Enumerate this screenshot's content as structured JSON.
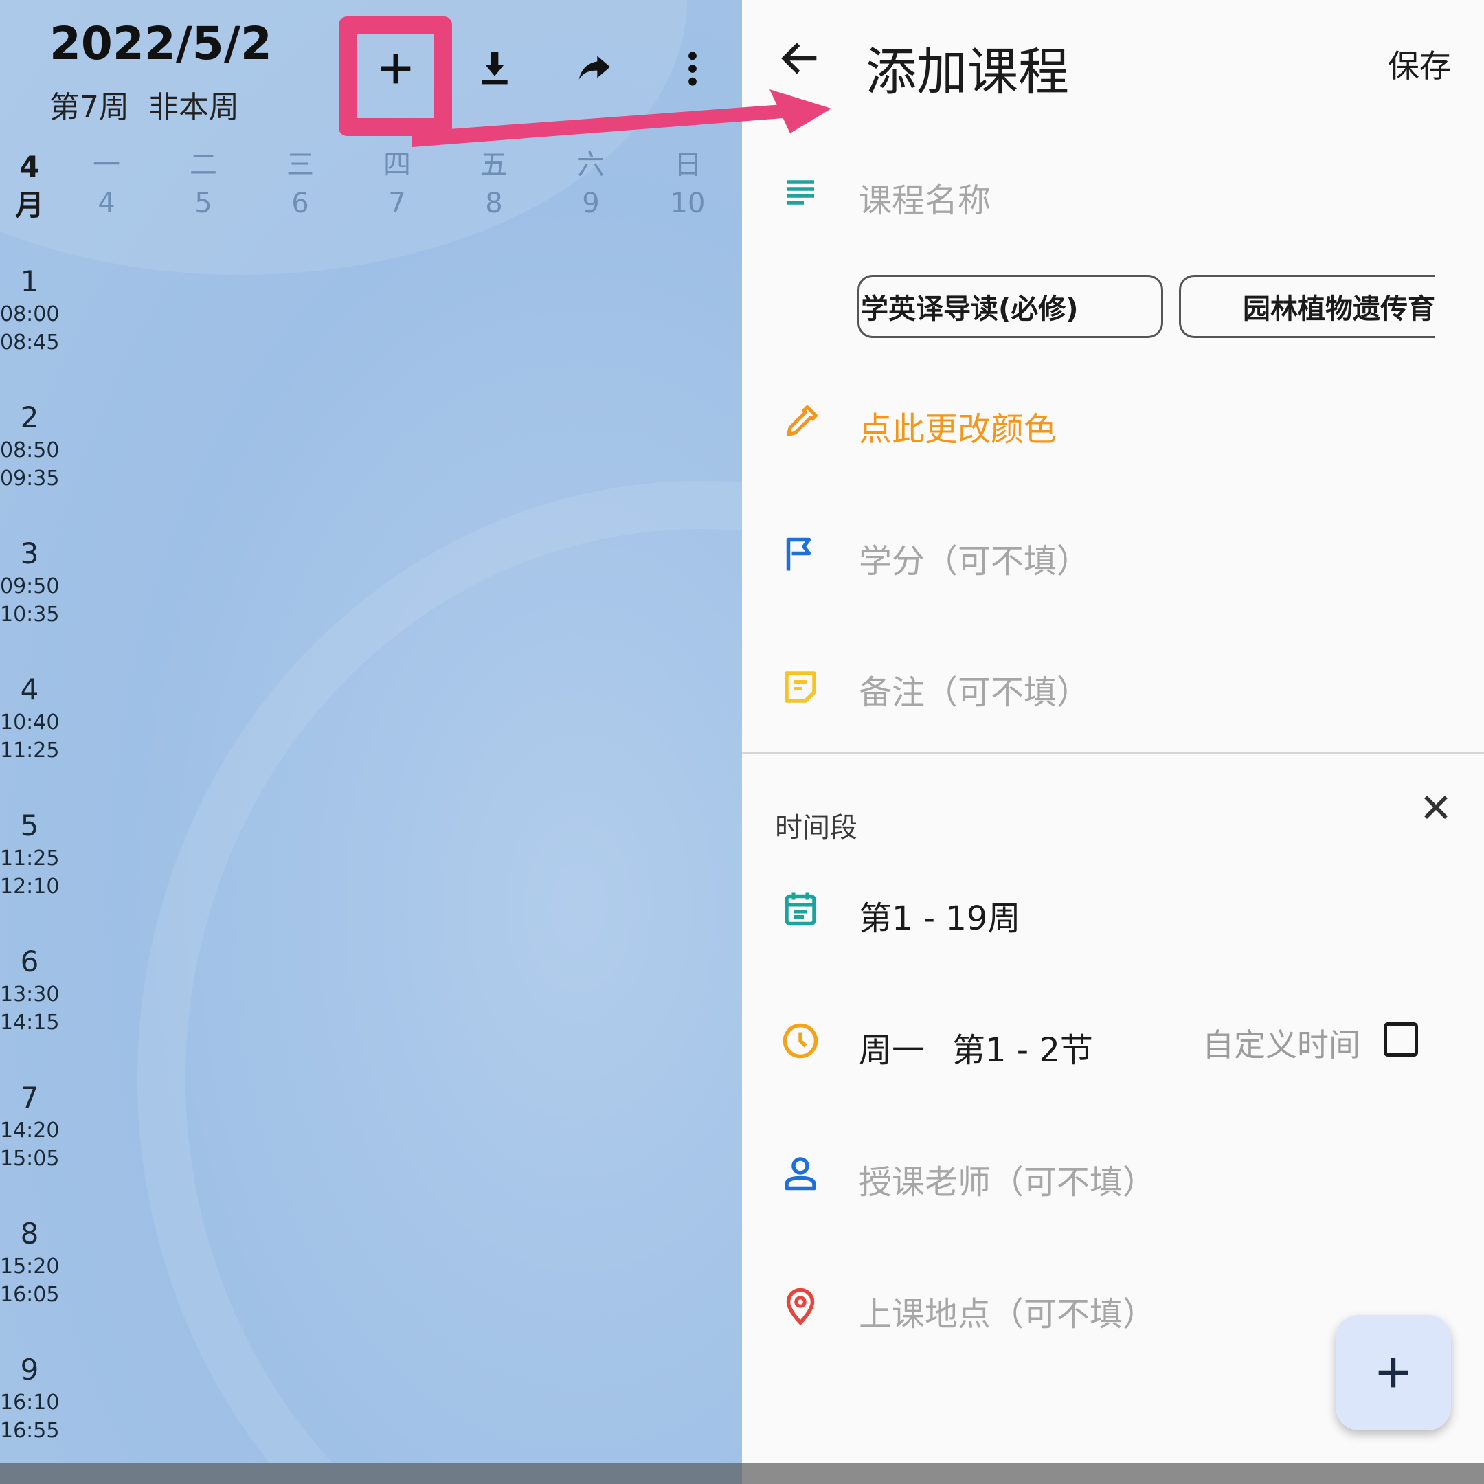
{
  "schedule": {
    "date": "2022/5/2",
    "week_info": "第7周  非本周",
    "toolbar": {
      "add_icon": "plus-icon",
      "import_icon": "download-icon",
      "share_icon": "share-icon",
      "more_icon": "more-vert-icon"
    },
    "month": {
      "num": "4",
      "label": "月"
    },
    "days": [
      {
        "name": "一",
        "date": "4"
      },
      {
        "name": "二",
        "date": "5"
      },
      {
        "name": "三",
        "date": "6"
      },
      {
        "name": "四",
        "date": "7"
      },
      {
        "name": "五",
        "date": "8"
      },
      {
        "name": "六",
        "date": "9"
      },
      {
        "name": "日",
        "date": "10"
      }
    ],
    "slots": [
      {
        "num": "1",
        "start": "08:00",
        "end": "08:45"
      },
      {
        "num": "2",
        "start": "08:50",
        "end": "09:35"
      },
      {
        "num": "3",
        "start": "09:50",
        "end": "10:35"
      },
      {
        "num": "4",
        "start": "10:40",
        "end": "11:25"
      },
      {
        "num": "5",
        "start": "11:25",
        "end": "12:10"
      },
      {
        "num": "6",
        "start": "13:30",
        "end": "14:15"
      },
      {
        "num": "7",
        "start": "14:20",
        "end": "15:05"
      },
      {
        "num": "8",
        "start": "15:20",
        "end": "16:05"
      },
      {
        "num": "9",
        "start": "16:10",
        "end": "16:55"
      }
    ]
  },
  "add_course": {
    "title": "添加课程",
    "save_label": "保存",
    "course_name_placeholder": "课程名称",
    "suggestions": [
      "学英译导读(必修)",
      "园林植物遗传育"
    ],
    "color_label": "点此更改颜色",
    "credit_placeholder": "学分（可不填）",
    "note_placeholder": "备注（可不填）",
    "section_label": "时间段",
    "weeks": "第1 - 19周",
    "day": "周一",
    "periods": "第1 - 2节",
    "custom_time_label": "自定义时间",
    "custom_time_checked": false,
    "teacher_placeholder": "授课老师（可不填）",
    "location_placeholder": "上课地点（可不填）"
  },
  "colors": {
    "highlight": "#e9437c",
    "orange": "#f4961a",
    "teal": "#1ba39c",
    "blue": "#1e6fd9",
    "yellow": "#f7c325",
    "red": "#e5453d",
    "fab_bg": "#dce6fb"
  }
}
